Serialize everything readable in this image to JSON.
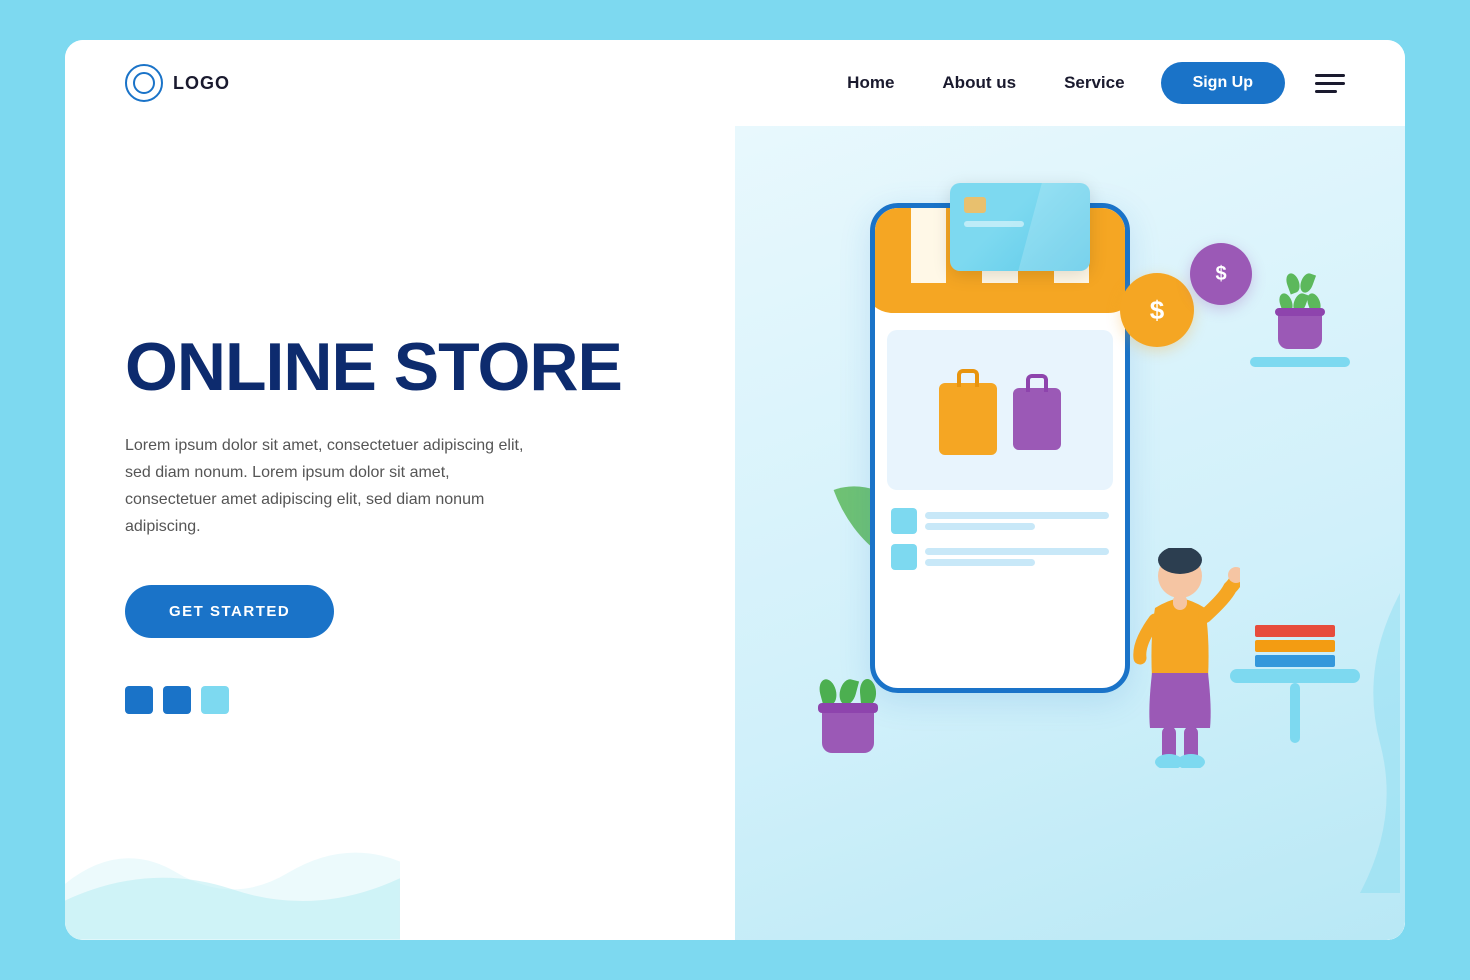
{
  "navbar": {
    "logo_text": "LOGO",
    "nav_home": "Home",
    "nav_about": "About us",
    "nav_service": "Service",
    "signup_label": "Sign Up"
  },
  "hero": {
    "title": "ONLINE STORE",
    "description": "Lorem ipsum dolor sit amet, consectetuer adipiscing elit, sed diam nonum. Lorem ipsum dolor sit amet, consectetuer amet adipiscing elit, sed diam nonum adipiscing.",
    "cta_label": "GET STARTED"
  },
  "dots": [
    {
      "color": "blue"
    },
    {
      "color": "blue"
    },
    {
      "color": "light"
    }
  ]
}
